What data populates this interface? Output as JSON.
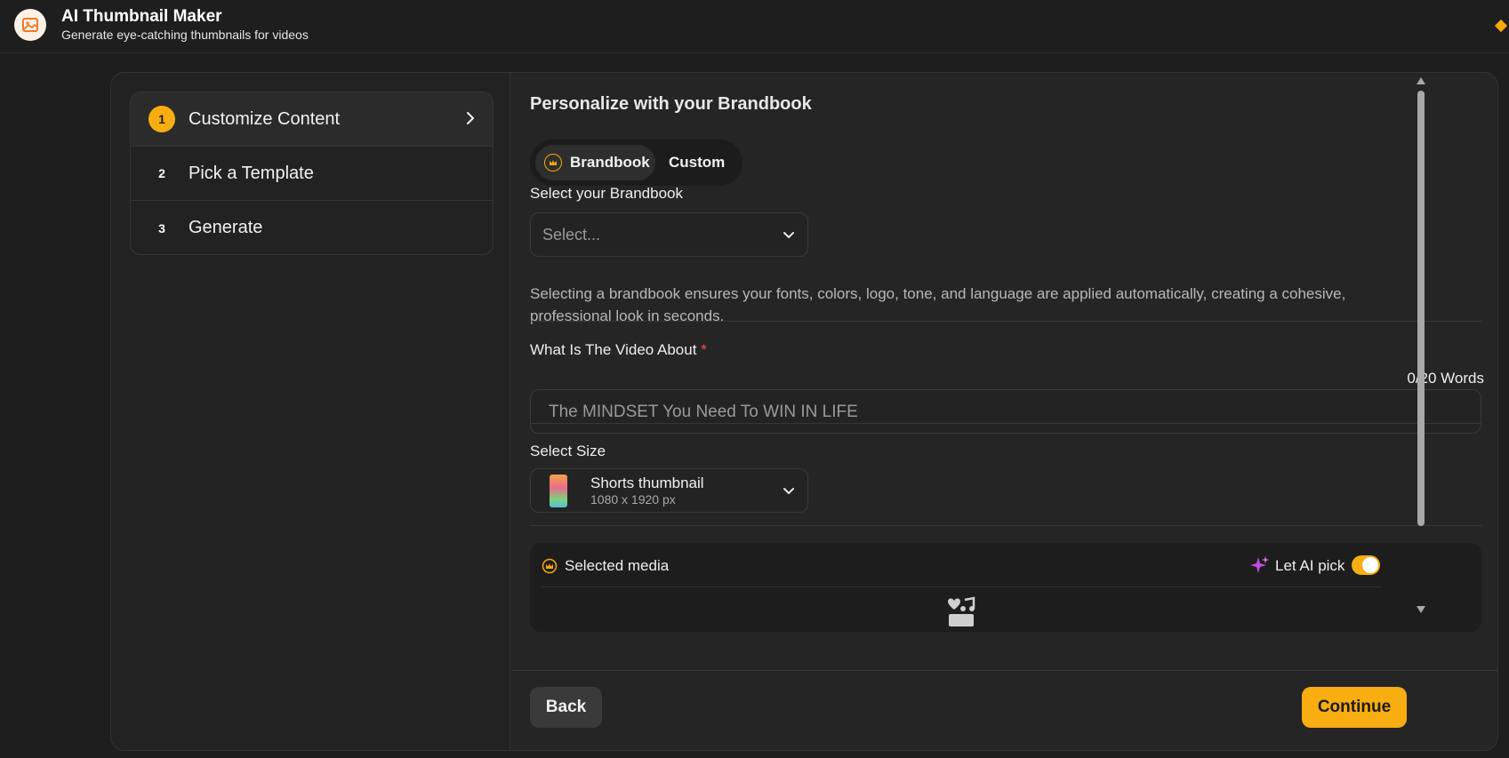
{
  "app": {
    "title": "AI Thumbnail Maker",
    "subtitle": "Generate eye-catching thumbnails for videos",
    "logo_icon": "image-icon"
  },
  "steps": [
    {
      "number": "1",
      "label": "Customize Content",
      "active": true
    },
    {
      "number": "2",
      "label": "Pick a Template",
      "active": false
    },
    {
      "number": "3",
      "label": "Generate",
      "active": false
    }
  ],
  "brandbook": {
    "section_title": "Personalize with your Brandbook",
    "toggle": {
      "brandbook": "Brandbook",
      "custom": "Custom",
      "selected": "Brandbook"
    },
    "select_label": "Select your Brandbook",
    "select_placeholder": "Select...",
    "help_text": "Selecting a brandbook ensures your fonts, colors, logo, tone, and language are applied automatically, creating a cohesive, professional look in seconds."
  },
  "video_about": {
    "label": "What Is The Video About",
    "required_mark": "*",
    "word_count": "0/20 Words",
    "placeholder": "The MINDSET You Need To WIN IN LIFE"
  },
  "size": {
    "label": "Select Size",
    "selected_name": "Shorts thumbnail",
    "selected_dims": "1080 x 1920 px"
  },
  "media": {
    "label": "Selected media",
    "ai_pick_label": "Let AI pick",
    "ai_pick_on": true
  },
  "footer": {
    "back_label": "Back",
    "continue_label": "Continue"
  },
  "colors": {
    "accent": "#f8ad10",
    "background": "#1e1e1e",
    "panel": "#252525"
  }
}
